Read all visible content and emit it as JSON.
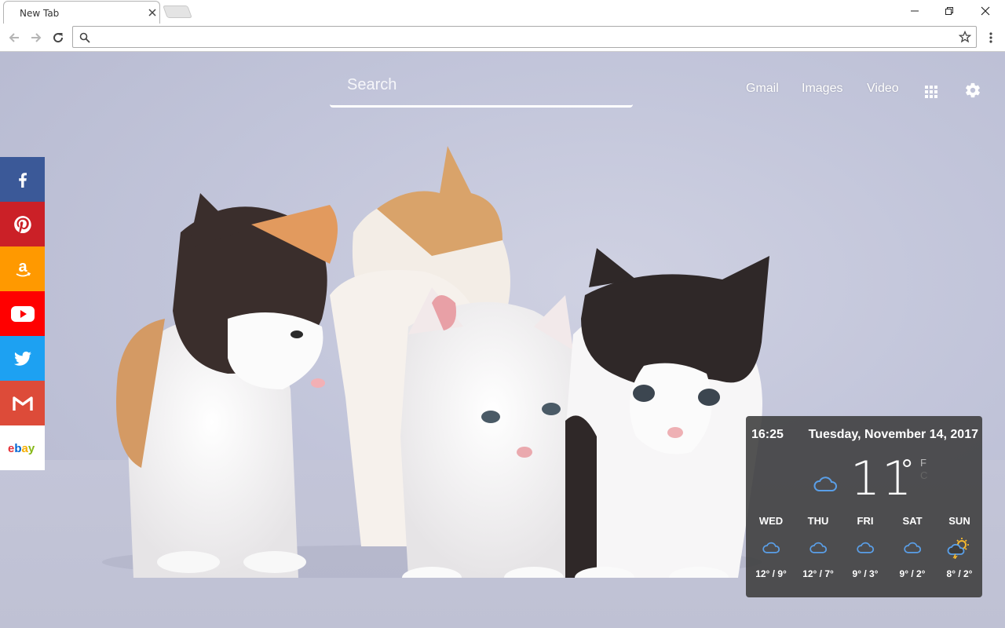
{
  "browser": {
    "tab_title": "New Tab",
    "address_value": "",
    "address_placeholder": ""
  },
  "newtab": {
    "search_placeholder": "Search",
    "links": [
      "Gmail",
      "Images",
      "Video"
    ]
  },
  "social": [
    {
      "name": "facebook",
      "color": "#3b5998"
    },
    {
      "name": "pinterest",
      "color": "#cb2027"
    },
    {
      "name": "amazon",
      "color": "#ff9900"
    },
    {
      "name": "youtube",
      "color": "#ff0000"
    },
    {
      "name": "twitter",
      "color": "#1da1f2"
    },
    {
      "name": "gmail",
      "color": "#dd4b39"
    },
    {
      "name": "ebay",
      "color": "#ffffff",
      "label": "ebay"
    }
  ],
  "weather": {
    "time": "16:25",
    "date": "Tuesday, November 14, 2017",
    "temp": "11",
    "deg": "°",
    "unit_f": "F",
    "unit_c": "C",
    "current_icon": "cloud-icon",
    "forecast": [
      {
        "day": "WED",
        "temps": "12° / 9°",
        "icon": "cloud-icon"
      },
      {
        "day": "THU",
        "temps": "12° / 7°",
        "icon": "cloud-icon"
      },
      {
        "day": "FRI",
        "temps": "9° / 3°",
        "icon": "cloud-icon"
      },
      {
        "day": "SAT",
        "temps": "9° / 2°",
        "icon": "cloud-icon"
      },
      {
        "day": "SUN",
        "temps": "8° / 2°",
        "icon": "sun-storm-icon"
      }
    ]
  }
}
